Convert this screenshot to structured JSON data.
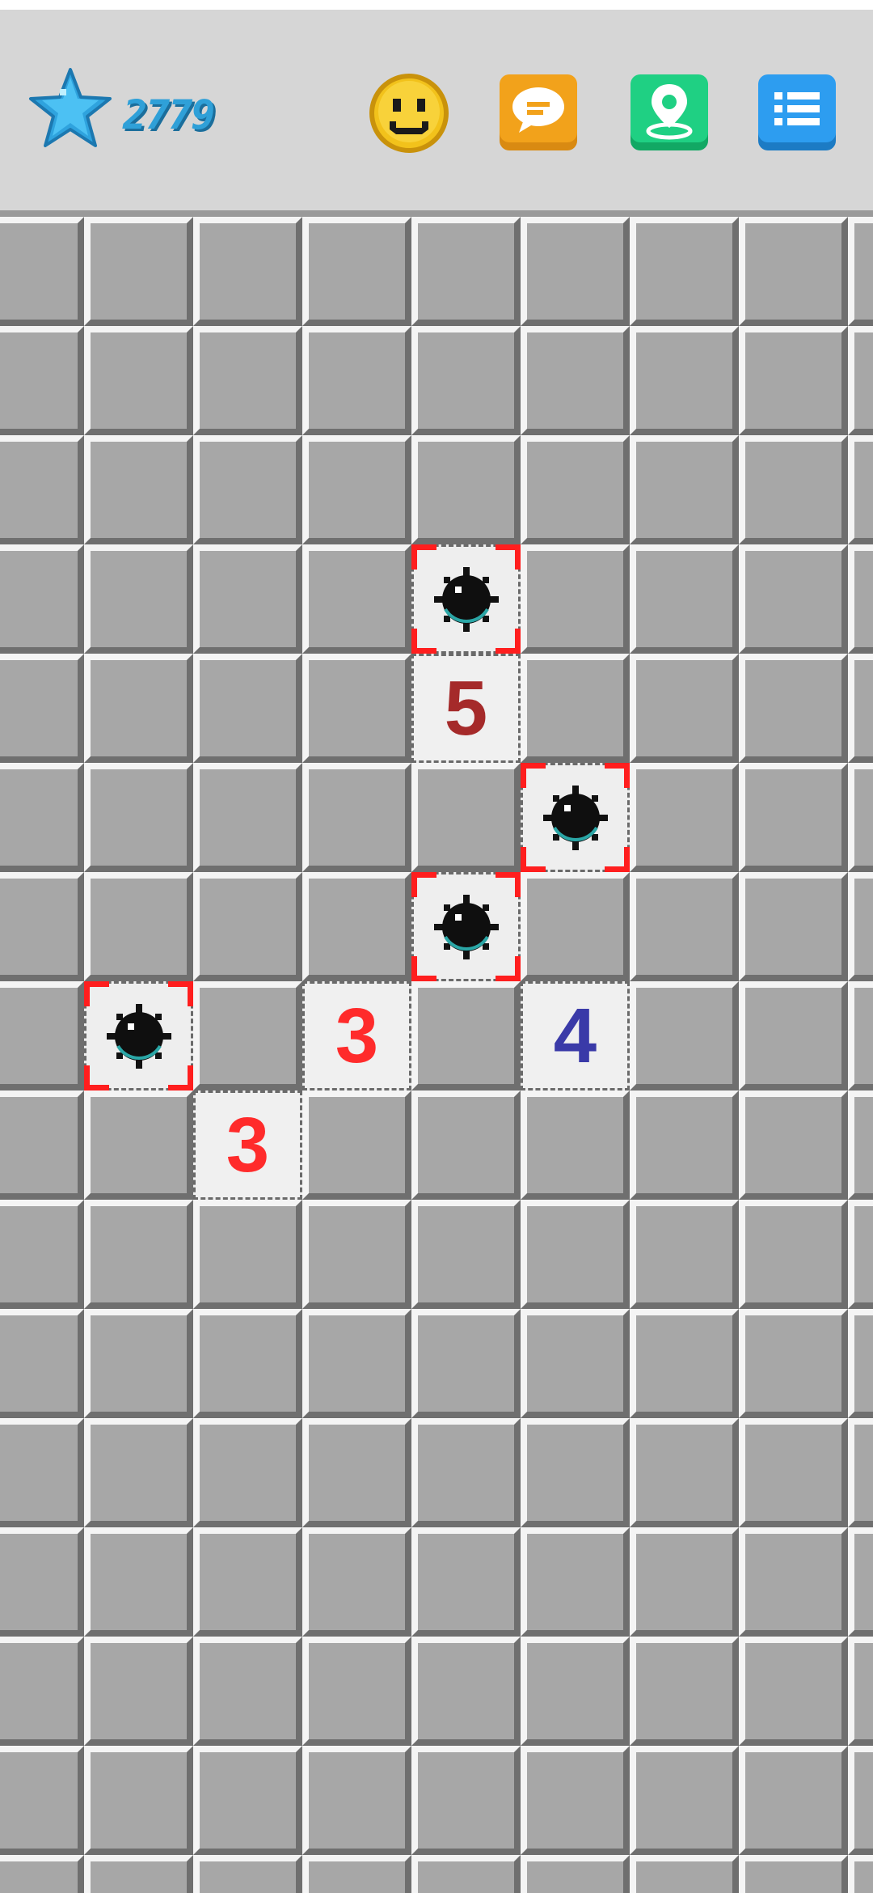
{
  "header": {
    "score": "2779",
    "buttons": [
      {
        "id": "face",
        "icon": "smiley-face-icon"
      },
      {
        "id": "chat",
        "icon": "chat-bubble-icon"
      },
      {
        "id": "map",
        "icon": "map-pin-icon"
      },
      {
        "id": "menu",
        "icon": "list-menu-icon"
      }
    ]
  },
  "colors": {
    "score": "#2fa0d8",
    "star": "#2fa3de",
    "face": "#f2c21b",
    "chat": "#f2a21b",
    "map": "#1fd083",
    "menu": "#2d9df0",
    "flag_corner": "#ff1e1e",
    "num_3": "#ff2b2b",
    "num_4": "#3a3aa8",
    "num_5": "#a52a2a"
  },
  "board": {
    "rows": 15,
    "cols": 8,
    "revealed": [
      {
        "row": 3,
        "col": 4,
        "type": "mine"
      },
      {
        "row": 4,
        "col": 4,
        "type": "number",
        "value": "5",
        "color": "#a52a2a"
      },
      {
        "row": 5,
        "col": 5,
        "type": "mine"
      },
      {
        "row": 6,
        "col": 4,
        "type": "mine"
      },
      {
        "row": 7,
        "col": 1,
        "type": "mine"
      },
      {
        "row": 7,
        "col": 3,
        "type": "number",
        "value": "3",
        "color": "#ff2b2b"
      },
      {
        "row": 7,
        "col": 5,
        "type": "number",
        "value": "4",
        "color": "#3a3aa8"
      },
      {
        "row": 8,
        "col": 2,
        "type": "number",
        "value": "3",
        "color": "#ff2b2b"
      }
    ]
  }
}
